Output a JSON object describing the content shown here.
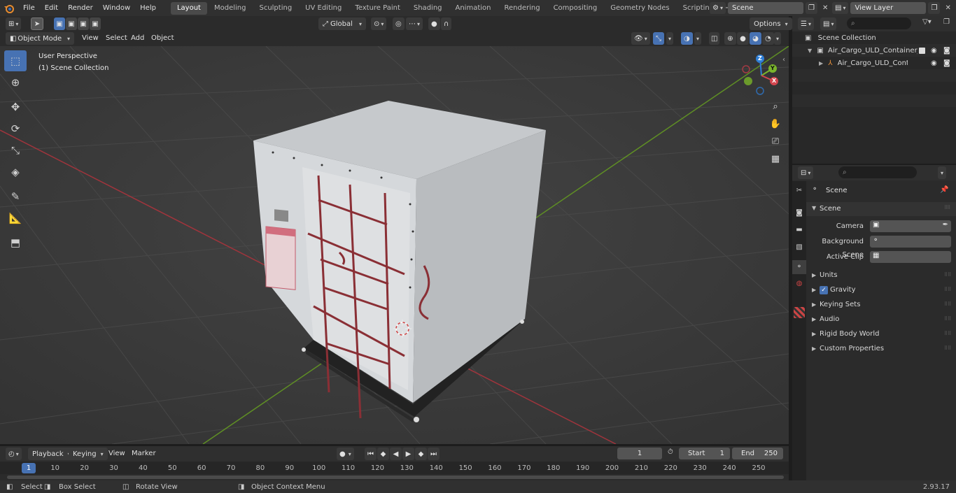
{
  "menu": {
    "file": "File",
    "edit": "Edit",
    "render": "Render",
    "window": "Window",
    "help": "Help"
  },
  "workspaces": [
    "Layout",
    "Modeling",
    "Sculpting",
    "UV Editing",
    "Texture Paint",
    "Shading",
    "Animation",
    "Rendering",
    "Compositing",
    "Geometry Nodes",
    "Scripting"
  ],
  "scene_selector": {
    "value": "Scene"
  },
  "view_layer_selector": {
    "value": "View Layer"
  },
  "header": {
    "mode": "Object Mode",
    "view": "View",
    "select": "Select",
    "add": "Add",
    "object": "Object",
    "transform_orientation": "Global",
    "options": "Options"
  },
  "viewport": {
    "perspective_label": "User Perspective",
    "collection_label": "(1) Scene Collection",
    "gizmo": {
      "x": "X",
      "y": "Y",
      "z": "Z"
    }
  },
  "outliner": {
    "root": "Scene Collection",
    "items": [
      {
        "label": "Air_Cargo_ULD_Container_LD"
      },
      {
        "label": "Air_Cargo_ULD_Containe"
      }
    ]
  },
  "properties": {
    "context": "Scene",
    "panel_title": "Scene",
    "fields": [
      {
        "label": "Camera"
      },
      {
        "label": "Background Scene"
      },
      {
        "label": "Active Clip"
      }
    ],
    "subpanels": [
      {
        "label": "Units"
      },
      {
        "label": "Gravity",
        "checked": true
      },
      {
        "label": "Keying Sets"
      },
      {
        "label": "Audio"
      },
      {
        "label": "Rigid Body World"
      },
      {
        "label": "Custom Properties"
      }
    ]
  },
  "timeline": {
    "playback": "Playback",
    "keying": "Keying",
    "view": "View",
    "marker": "Marker",
    "current_frame": "1",
    "start_label": "Start",
    "start_value": "1",
    "end_label": "End",
    "end_value": "250",
    "ticks": [
      "1",
      "10",
      "20",
      "30",
      "40",
      "50",
      "60",
      "70",
      "80",
      "90",
      "100",
      "110",
      "120",
      "130",
      "140",
      "150",
      "160",
      "170",
      "180",
      "190",
      "200",
      "210",
      "220",
      "230",
      "240",
      "250"
    ]
  },
  "statusbar": {
    "select": "Select",
    "box_select": "Box Select",
    "rotate_view": "Rotate View",
    "context_menu": "Object Context Menu",
    "version": "2.93.17"
  },
  "colors": {
    "accent": "#4772b3",
    "x_axis": "#d3454e",
    "y_axis": "#7ab52c",
    "z_axis": "#2f7fd6"
  }
}
